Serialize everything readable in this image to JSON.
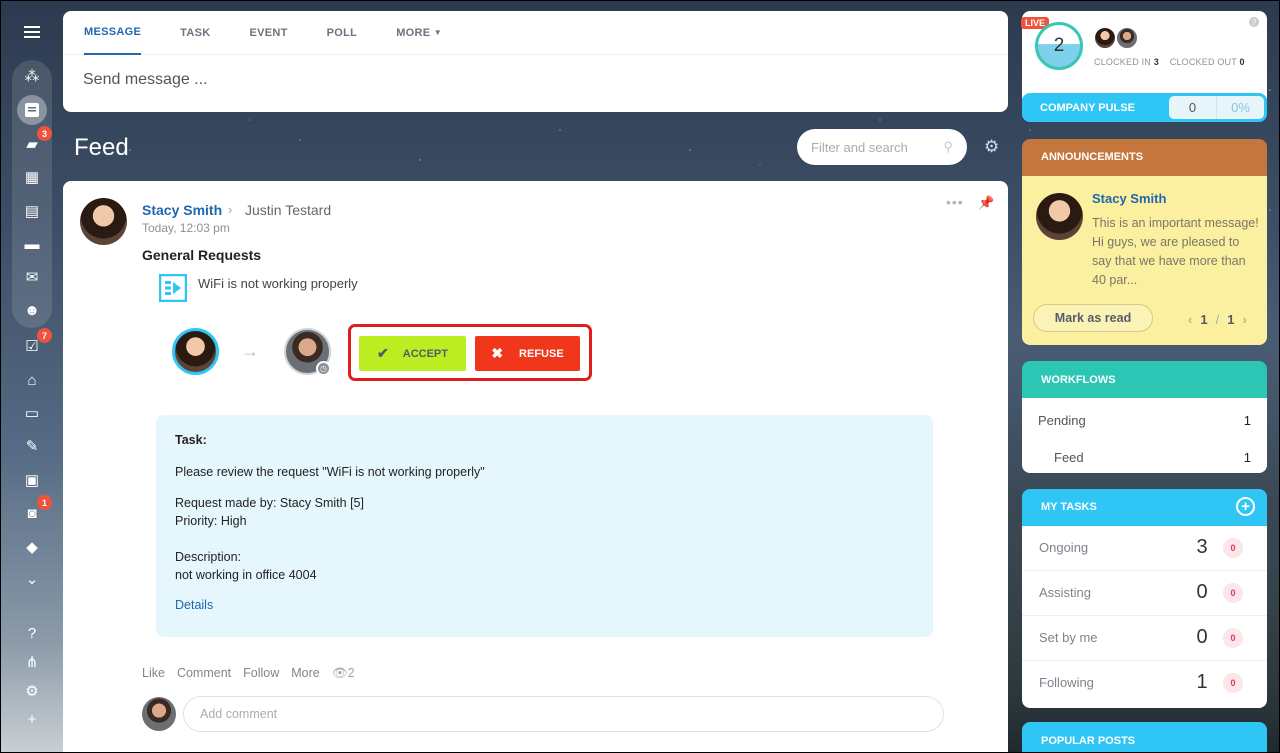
{
  "composer": {
    "tabs": [
      "MESSAGE",
      "TASK",
      "EVENT",
      "POLL",
      "MORE"
    ],
    "placeholder": "Send message ..."
  },
  "feed": {
    "title": "Feed",
    "filter_placeholder": "Filter and search"
  },
  "sidebar": {
    "badges": {
      "chat": "3",
      "tasks": "7",
      "bot": "1"
    }
  },
  "post": {
    "author": "Stacy Smith",
    "recipient": "Justin Testard",
    "time": "Today, 12:03 pm",
    "title": "General Requests",
    "workflow_name": "WiFi is not working properly",
    "accept_label": "ACCEPT",
    "refuse_label": "REFUSE",
    "task": {
      "heading": "Task:",
      "line1": "Please review the request \"WiFi is not working properly\"",
      "requested_by": "Request made by: Stacy Smith [5]",
      "priority": "Priority: High",
      "desc_label": "Description:",
      "desc": "not working in office 4004",
      "details_link": "Details"
    },
    "actions": [
      "Like",
      "Comment",
      "Follow",
      "More"
    ],
    "views": "2",
    "comment_placeholder": "Add comment"
  },
  "timeman": {
    "live": "LIVE",
    "count": "2",
    "clocked_in_label": "CLOCKED IN",
    "clocked_in": "3",
    "clocked_out_label": "CLOCKED OUT",
    "clocked_out": "0"
  },
  "pulse": {
    "label": "COMPANY PULSE",
    "value": "0",
    "percent": "0%"
  },
  "announcements": {
    "title": "ANNOUNCEMENTS",
    "author": "Stacy Smith",
    "text": "This is an important message! Hi guys, we are pleased to say that we have more than 40 par...",
    "mark_read": "Mark as read",
    "page": "1",
    "sep": "/",
    "total": "1"
  },
  "workflows": {
    "title": "WORKFLOWS",
    "rows": [
      {
        "label": "Pending",
        "value": "1"
      },
      {
        "label": "Feed",
        "value": "1"
      }
    ]
  },
  "my_tasks": {
    "title": "MY TASKS",
    "rows": [
      {
        "label": "Ongoing",
        "count": "3",
        "overdue": "0"
      },
      {
        "label": "Assisting",
        "count": "0",
        "overdue": "0"
      },
      {
        "label": "Set by me",
        "count": "0",
        "overdue": "0"
      },
      {
        "label": "Following",
        "count": "1",
        "overdue": "0"
      }
    ]
  },
  "popular_posts": {
    "title": "POPULAR POSTS"
  },
  "colors": {
    "accent_blue": "#2067b0",
    "accept": "#bbed21",
    "refuse": "#f0371b",
    "workflows": "#2bc7b4",
    "announcements": "#c5763c",
    "tasks": "#2fc6f6"
  }
}
